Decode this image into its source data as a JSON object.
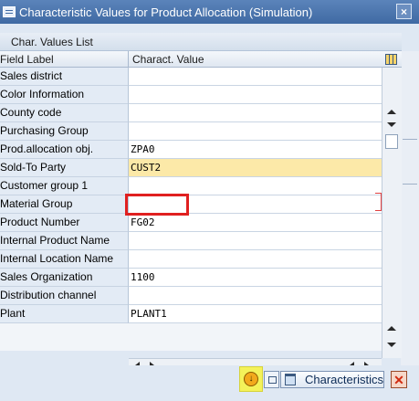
{
  "window": {
    "title": "Characteristic Values for Product Allocation (Simulation)",
    "close_glyph": "×"
  },
  "table": {
    "title": "Char. Values List",
    "columns": {
      "label": "Field Label",
      "value": "Charact. Value"
    },
    "rows": [
      {
        "label": "Sales district",
        "value": ""
      },
      {
        "label": "Color Information",
        "value": ""
      },
      {
        "label": "County code",
        "value": ""
      },
      {
        "label": "Purchasing Group",
        "value": ""
      },
      {
        "label": "Prod.allocation obj.",
        "value": "ZPA0"
      },
      {
        "label": "Sold-To Party",
        "value": "CUST2"
      },
      {
        "label": "Customer group 1",
        "value": ""
      },
      {
        "label": "Material Group",
        "value": ""
      },
      {
        "label": "Product Number",
        "value": "FG02"
      },
      {
        "label": "Internal Product Name",
        "value": ""
      },
      {
        "label": "Internal Location Name",
        "value": ""
      },
      {
        "label": "Sales Organization",
        "value": "1100"
      },
      {
        "label": "Distribution channel",
        "value": ""
      },
      {
        "label": "Plant",
        "value": "PLANT1"
      }
    ]
  },
  "toolbar": {
    "characteristics_label": "Characteristics",
    "cancel_glyph": "✕"
  },
  "colors": {
    "title_bar": "#3f6aa3",
    "selected_row": "#fce9a8",
    "highlight_box": "#e02020",
    "copy_button_highlight": "#f4f25a"
  }
}
